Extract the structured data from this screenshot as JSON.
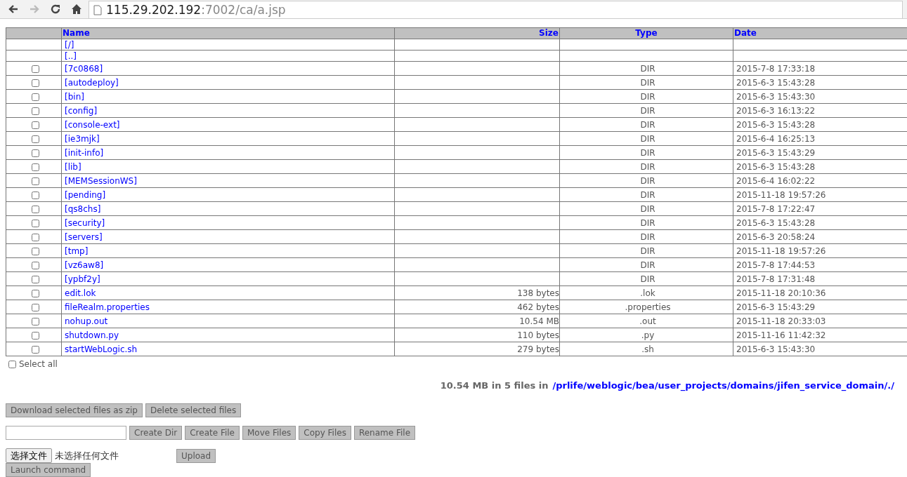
{
  "browser": {
    "url_host": "115.29.202.192",
    "url_path": ":7002/ca/a.jsp",
    "forward_disabled": true
  },
  "table": {
    "columns": [
      "Name",
      "Size",
      "Type",
      "Date"
    ],
    "nav_rows": [
      "[/]",
      "[..]"
    ],
    "rows": [
      {
        "name": "[7c0868]",
        "size": "",
        "type": "DIR",
        "date": "2015-7-8 17:33:18",
        "checked": false
      },
      {
        "name": "[autodeploy]",
        "size": "",
        "type": "DIR",
        "date": "2015-6-3 15:43:28",
        "checked": false
      },
      {
        "name": "[bin]",
        "size": "",
        "type": "DIR",
        "date": "2015-6-3 15:43:30",
        "checked": false
      },
      {
        "name": "[config]",
        "size": "",
        "type": "DIR",
        "date": "2015-6-3 16:13:22",
        "checked": false
      },
      {
        "name": "[console-ext]",
        "size": "",
        "type": "DIR",
        "date": "2015-6-3 15:43:28",
        "checked": false
      },
      {
        "name": "[ie3mjk]",
        "size": "",
        "type": "DIR",
        "date": "2015-6-4 16:25:13",
        "checked": false
      },
      {
        "name": "[init-info]",
        "size": "",
        "type": "DIR",
        "date": "2015-6-3 15:43:29",
        "checked": false
      },
      {
        "name": "[lib]",
        "size": "",
        "type": "DIR",
        "date": "2015-6-3 15:43:28",
        "checked": false
      },
      {
        "name": "[MEMSessionWS]",
        "size": "",
        "type": "DIR",
        "date": "2015-6-4 16:02:22",
        "checked": false
      },
      {
        "name": "[pending]",
        "size": "",
        "type": "DIR",
        "date": "2015-11-18 19:57:26",
        "checked": false
      },
      {
        "name": "[qs8chs]",
        "size": "",
        "type": "DIR",
        "date": "2015-7-8 17:22:47",
        "checked": false
      },
      {
        "name": "[security]",
        "size": "",
        "type": "DIR",
        "date": "2015-6-3 15:43:28",
        "checked": false
      },
      {
        "name": "[servers]",
        "size": "",
        "type": "DIR",
        "date": "2015-6-3 20:58:24",
        "checked": false
      },
      {
        "name": "[tmp]",
        "size": "",
        "type": "DIR",
        "date": "2015-11-18 19:57:26",
        "checked": false
      },
      {
        "name": "[vz6aw8]",
        "size": "",
        "type": "DIR",
        "date": "2015-7-8 17:44:53",
        "checked": false
      },
      {
        "name": "[ypbf2y]",
        "size": "",
        "type": "DIR",
        "date": "2015-7-8 17:31:48",
        "checked": false
      },
      {
        "name": "edit.lok",
        "size": "138 bytes",
        "type": ".lok",
        "date": "2015-11-18 20:10:36",
        "checked": false
      },
      {
        "name": "fileRealm.properties",
        "size": "462 bytes",
        "type": ".properties",
        "date": "2015-6-3 15:43:29",
        "checked": false
      },
      {
        "name": "nohup.out",
        "size": "10.54 MB",
        "type": ".out",
        "date": "2015-11-18 20:33:03",
        "checked": false
      },
      {
        "name": "shutdown.py",
        "size": "110 bytes",
        "type": ".py",
        "date": "2015-11-16 11:42:32",
        "checked": false
      },
      {
        "name": "startWebLogic.sh",
        "size": "279 bytes",
        "type": ".sh",
        "date": "2015-6-3 15:43:30",
        "checked": false
      }
    ]
  },
  "select_all": {
    "label": "Select all",
    "checked": false
  },
  "summary": {
    "text": "10.54 MB in 5 files in",
    "path": "/prlife/weblogic/bea/user_projects/domains/jifen_service_domain/./"
  },
  "selection_buttons": [
    "Download selected files as zip",
    "Delete selected files"
  ],
  "file_buttons": [
    "Create Dir",
    "Create File",
    "Move Files",
    "Copy Files",
    "Rename File"
  ],
  "upload": {
    "choose_button": "选择文件",
    "no_file": "未选择任何文件",
    "upload_button": "Upload"
  },
  "command_button": "Launch command"
}
